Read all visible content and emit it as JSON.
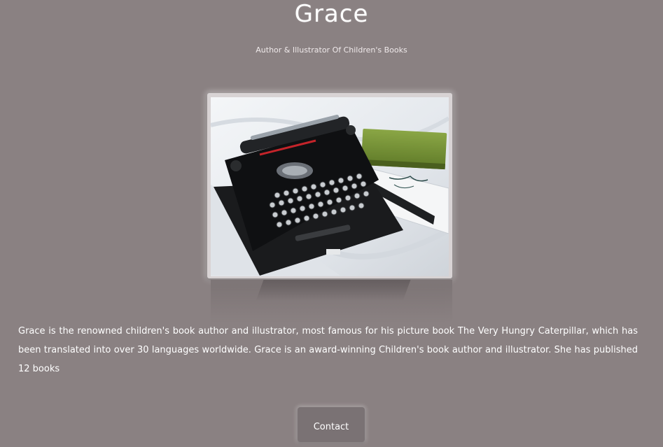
{
  "header": {
    "title": "Grace",
    "subtitle": "Author & Illustrator Of Children's Books"
  },
  "main": {
    "photo_subject": "typewriter-with-green-book",
    "bio": "Grace is the renowned children's book author and illustrator, most famous for his picture book The Very Hungry Caterpillar, which has been translated into over 30 languages worldwide. Grace is an award-winning Children's book author and illustrator. She has published 12 books"
  },
  "actions": {
    "contact_label": "Contact"
  },
  "colors": {
    "background": "#8a8182",
    "text": "#ffffff",
    "button": "#7a7274"
  }
}
